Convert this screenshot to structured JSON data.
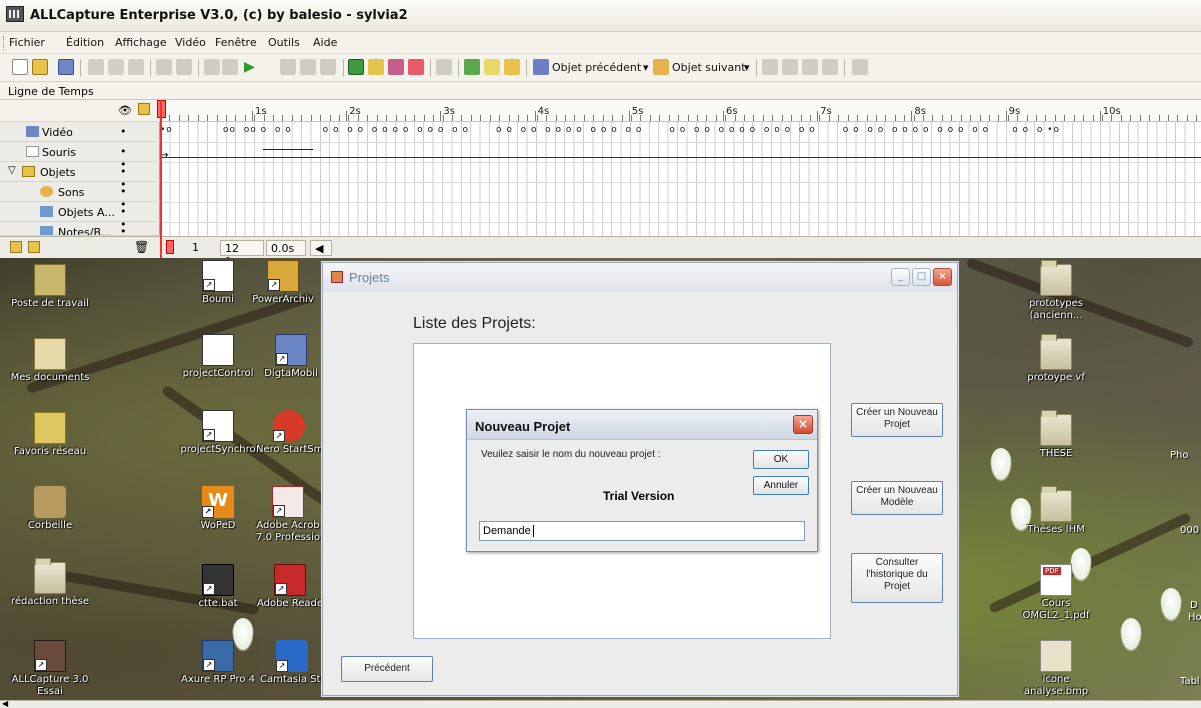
{
  "app": {
    "title": "ALLCapture Enterprise V3.0, (c) by balesio - sylvia2"
  },
  "menu": {
    "items": [
      "Fichier",
      "Édition",
      "Affichage",
      "Vidéo",
      "Fenêtre",
      "Outils",
      "Aide"
    ]
  },
  "toolbar": {
    "previous_object": "Objet précédent",
    "next_object": "Objet suivant"
  },
  "timeline": {
    "header": "Ligne de Temps",
    "ruler_labels": [
      "1s",
      "2s",
      "3s",
      "4s",
      "5s",
      "6s",
      "7s",
      "8s",
      "9s",
      "10s"
    ],
    "rows": [
      {
        "label": "Vidéo",
        "dots": "•"
      },
      {
        "label": "Souris",
        "dots": "• •"
      },
      {
        "label": "Objets",
        "dots": "• •"
      },
      {
        "label": "Sons",
        "dots": "• •"
      },
      {
        "label": "Objets A...",
        "dots": "• •"
      },
      {
        "label": "Notes/B...",
        "dots": "• •"
      }
    ],
    "frame": "1",
    "fps": "12 fps",
    "time": "0.0s"
  },
  "desktop": {
    "icons": [
      {
        "label": "Poste de travail",
        "icon": "computer-icon"
      },
      {
        "label": "Mes documents",
        "icon": "documents-icon"
      },
      {
        "label": "Favoris réseau",
        "icon": "network-icon"
      },
      {
        "label": "Corbeille",
        "icon": "recycle-bin-icon"
      },
      {
        "label": "rédaction thèse",
        "icon": "folder-icon"
      },
      {
        "label": "ALLCapture 3.0",
        "icon": "allcapture-icon"
      },
      {
        "label": "Essai",
        "icon": ""
      },
      {
        "label": "Boumi",
        "icon": "uml-icon"
      },
      {
        "label": "PowerArchiv",
        "icon": "archive-icon"
      },
      {
        "label": "projectControl",
        "icon": "project-control-icon"
      },
      {
        "label": "DigtaMobil",
        "icon": "digta-icon"
      },
      {
        "label": "projectSynchro",
        "icon": "project-synchro-icon"
      },
      {
        "label": "Nero StartSm",
        "icon": "nero-icon"
      },
      {
        "label": "WoPeD",
        "icon": "woped-icon"
      },
      {
        "label": "Adobe Acrob",
        "icon": "acrobat-icon"
      },
      {
        "label": "7.0 Professio",
        "icon": ""
      },
      {
        "label": "ctte.bat",
        "icon": "bat-icon"
      },
      {
        "label": "Adobe Reade",
        "icon": "adobe-reader-icon"
      },
      {
        "label": "Axure RP Pro 4",
        "icon": "axure-icon"
      },
      {
        "label": "Camtasia Stu",
        "icon": "camtasia-icon"
      },
      {
        "label": "prototypes",
        "icon": "folder-icon"
      },
      {
        "label": "(ancienn...",
        "icon": ""
      },
      {
        "label": "protoype vf",
        "icon": "folder-icon"
      },
      {
        "label": "THESE",
        "icon": "folder-icon"
      },
      {
        "label": "Thèses IHM",
        "icon": "folder-icon"
      },
      {
        "label": "Cours",
        "icon": "pdf-icon"
      },
      {
        "label": "OMGL2_1.pdf",
        "icon": ""
      },
      {
        "label": "icone",
        "icon": "image-icon"
      },
      {
        "label": "analyse.bmp",
        "icon": ""
      },
      {
        "label": "Pho",
        "icon": ""
      },
      {
        "label": "000",
        "icon": ""
      },
      {
        "label": "D",
        "icon": ""
      },
      {
        "label": "Ho",
        "icon": ""
      },
      {
        "label": "Tabl",
        "icon": ""
      }
    ]
  },
  "projets_window": {
    "title": "Projets",
    "list_title": "Liste des Projets:",
    "buttons": {
      "create_project": "Créer un Nouveau Projet",
      "create_model": "Créer un Nouveau Modèle",
      "history": "Consulter l'historique du Projet",
      "previous": "Précédent"
    }
  },
  "dialog": {
    "title": "Nouveau Projet",
    "prompt": "Veuilez saisir le nom du nouveau projet :",
    "ok": "OK",
    "cancel": "Annuler",
    "watermark": "Trial Version",
    "input_value": "Demande"
  }
}
